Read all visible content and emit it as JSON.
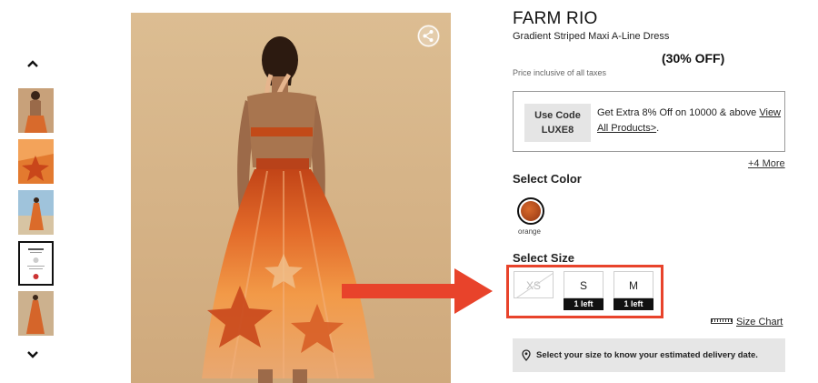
{
  "product": {
    "brand": "FARM RIO",
    "name": "Gradient Striped Maxi A-Line Dress",
    "discount": "(30% OFF)",
    "tax_note": "Price inclusive of all taxes"
  },
  "coupon": {
    "code_line1": "Use Code",
    "code_line2": "LUXE8",
    "text": "Get Extra 8% Off on 10000 & above ",
    "link": "View All Products>",
    "link_suffix": "."
  },
  "offers": {
    "more_link": "+4 More"
  },
  "color": {
    "title": "Select Color",
    "options": [
      {
        "label": "orange",
        "swatch": "#b9501f",
        "selected": true
      }
    ]
  },
  "size": {
    "title": "Select Size",
    "options": [
      {
        "label": "XS",
        "available": false,
        "stock": ""
      },
      {
        "label": "S",
        "available": true,
        "stock": "1 left"
      },
      {
        "label": "M",
        "available": true,
        "stock": "1 left"
      }
    ],
    "size_chart_label": "Size Chart"
  },
  "delivery": {
    "text": "Select your size to know your estimated delivery date."
  },
  "gallery": {
    "thumbnails": [
      "back-view",
      "print-detail",
      "beach-front-view",
      "certificate-card",
      "full-front-view"
    ],
    "selected_thumbnail": "certificate-card",
    "main_image": "dress-back-view"
  },
  "icons": {
    "up": "chevron-up-icon",
    "down": "chevron-down-icon",
    "share": "share-icon",
    "ruler": "ruler-icon",
    "pin": "location-pin-icon"
  },
  "colors": {
    "highlight": "#e8432b",
    "image_bg": "#d9b98e",
    "delivery_bg": "#e6e6e6",
    "badge": "#111111"
  }
}
